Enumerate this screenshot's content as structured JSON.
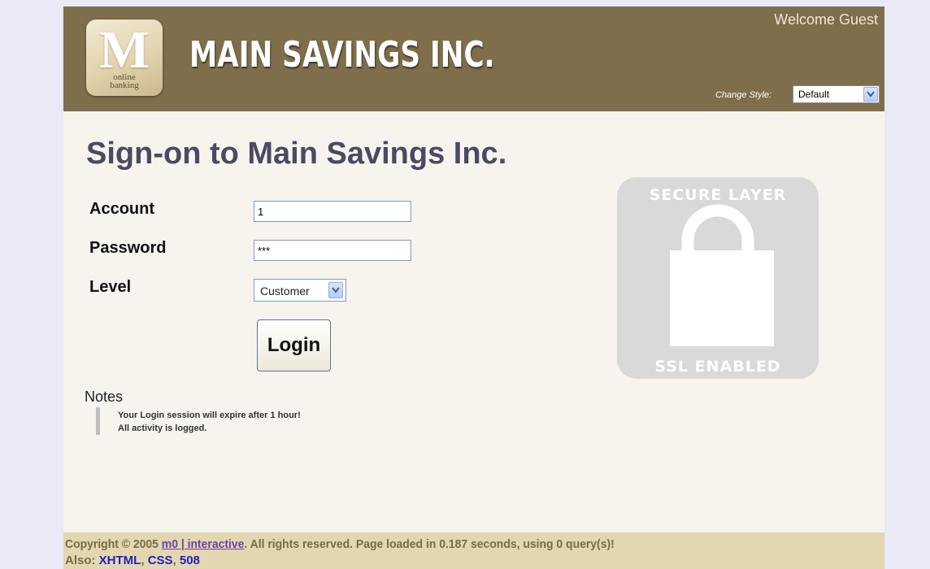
{
  "header": {
    "logo_letter": "M",
    "logo_subtitle": "online\nbanking",
    "brand_name": "MAIN SAVINGS INC.",
    "welcome": "Welcome Guest",
    "style_label": "Change Style:",
    "style_value": "Default"
  },
  "main": {
    "title": "Sign-on to Main Savings Inc.",
    "form": {
      "account_label": "Account",
      "account_value": "1",
      "password_label": "Password",
      "password_value": "***",
      "level_label": "Level",
      "level_value": "Customer",
      "login_label": "Login"
    },
    "notes": {
      "title": "Notes",
      "items": [
        "Your Login session will expire after 1 hour!",
        "All activity is logged."
      ]
    },
    "ssl_badge": {
      "top_text": "SECURE LAYER",
      "bottom_text": "SSL ENABLED",
      "icon": "padlock-icon"
    }
  },
  "footer": {
    "copyright_prefix": "Copyright © 2005 ",
    "company_link": "m0 | interactive",
    "copyright_suffix": ". All rights reserved. Page loaded in 0.187 seconds, using 0 query(s)!",
    "also_label": "Also: ",
    "links": [
      "XHTML",
      "CSS",
      "508"
    ],
    "link_separator": ", "
  },
  "colors": {
    "header_bg": "#7e6e4b",
    "content_bg": "#f7f4ed",
    "footer_bg": "#e3d7b1",
    "title_color": "#4a4a64",
    "badge_gray": "#d9d9d9"
  }
}
